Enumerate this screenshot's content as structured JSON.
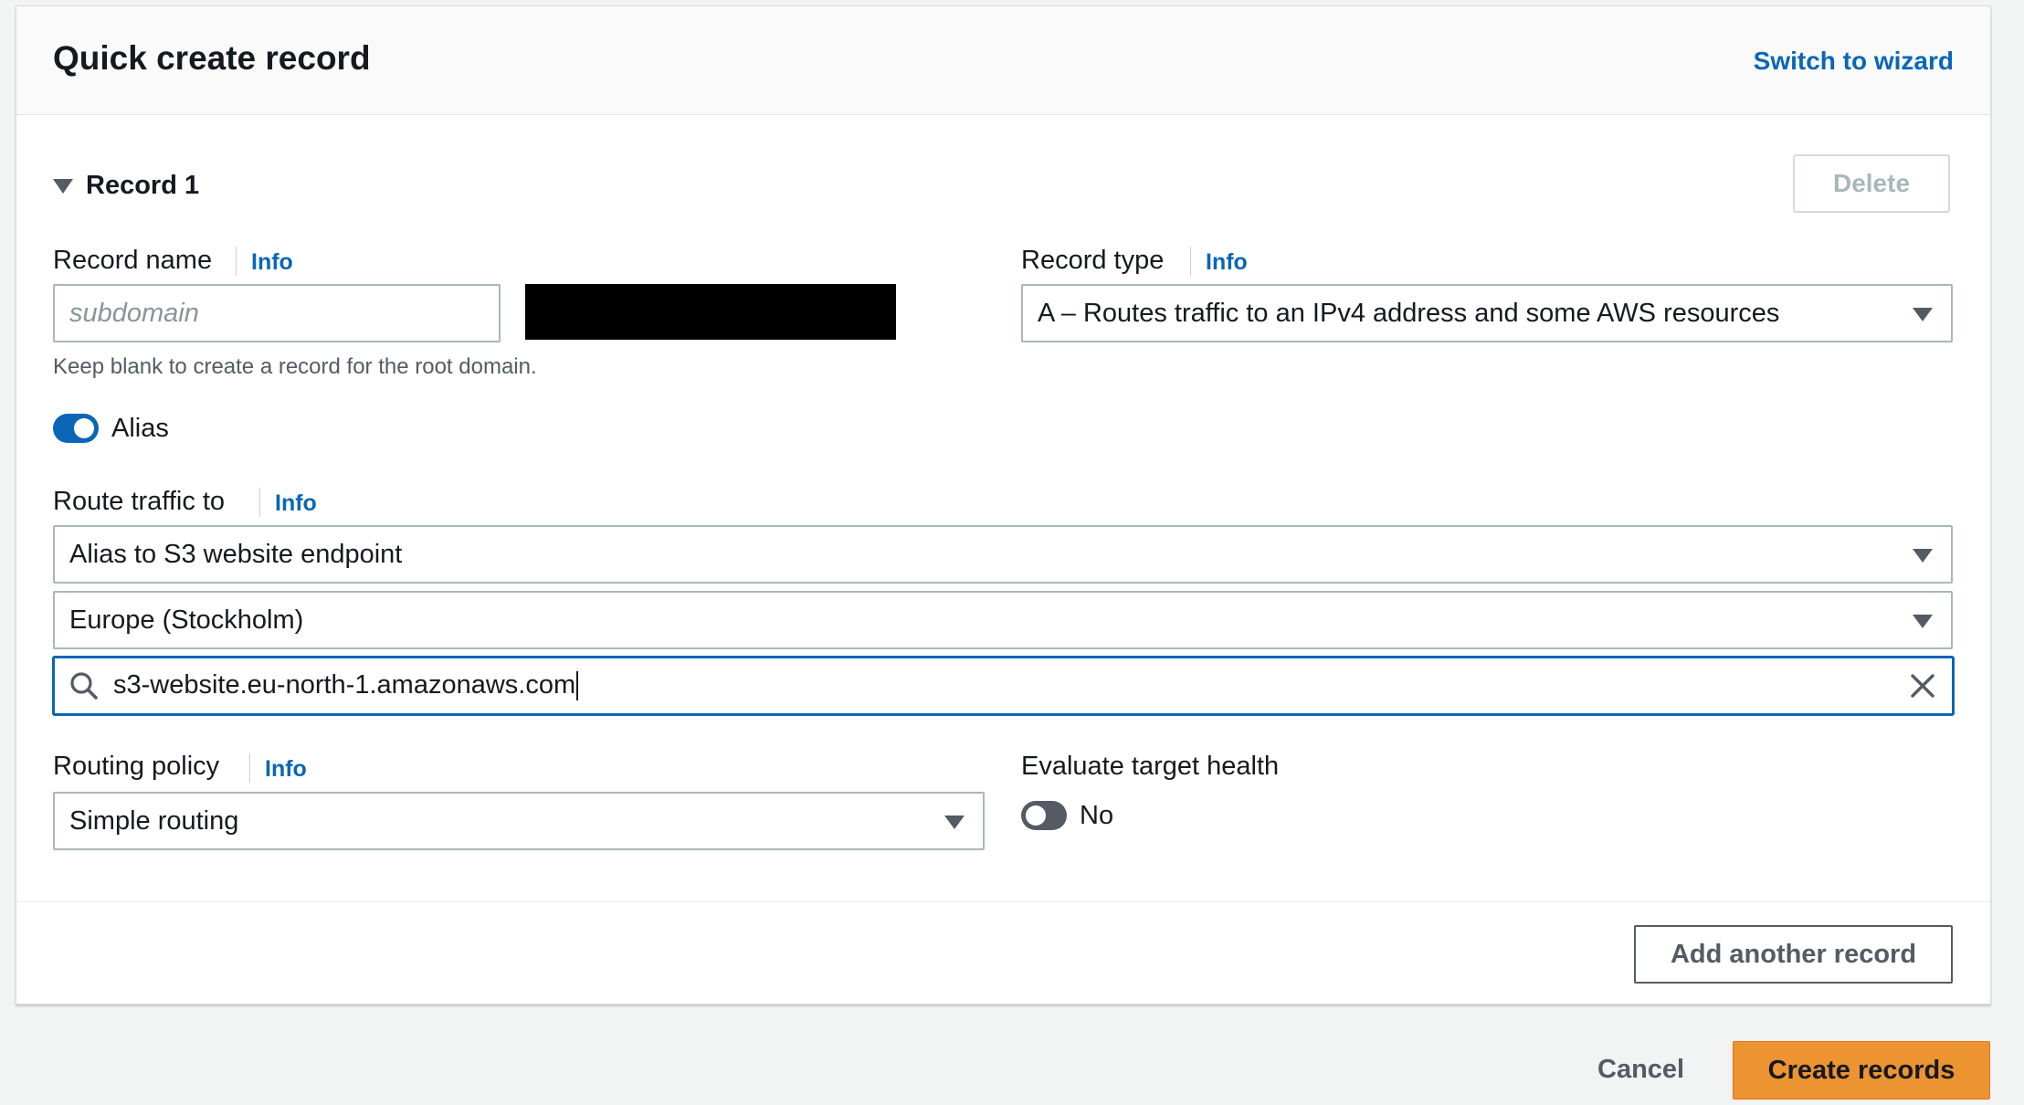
{
  "header": {
    "title": "Quick create record",
    "switch_link": "Switch to wizard"
  },
  "record": {
    "title": "Record 1",
    "delete_label": "Delete",
    "record_name": {
      "label": "Record name",
      "info": "Info",
      "placeholder": "subdomain",
      "value": "",
      "hint": "Keep blank to create a record for the root domain."
    },
    "record_type": {
      "label": "Record type",
      "info": "Info",
      "value": "A – Routes traffic to an IPv4 address and some AWS resources"
    },
    "alias": {
      "label": "Alias",
      "enabled": true
    },
    "route_traffic": {
      "label": "Route traffic to",
      "info": "Info",
      "endpoint_type": "Alias to S3 website endpoint",
      "region": "Europe (Stockholm)",
      "endpoint_value": "s3-website.eu-north-1.amazonaws.com"
    },
    "routing_policy": {
      "label": "Routing policy",
      "info": "Info",
      "value": "Simple routing"
    },
    "evaluate_health": {
      "label": "Evaluate target health",
      "value": "No",
      "enabled": false
    },
    "add_another_label": "Add another record"
  },
  "footer": {
    "cancel_label": "Cancel",
    "create_label": "Create records"
  },
  "colors": {
    "accent": "#0a66b7",
    "primary_button": "#ec9332",
    "background": "#f2f3f3"
  },
  "icons": {
    "record_expand": "caret-down-icon",
    "select_caret": "caret-down-icon",
    "search": "search-icon",
    "clear": "close-icon"
  }
}
